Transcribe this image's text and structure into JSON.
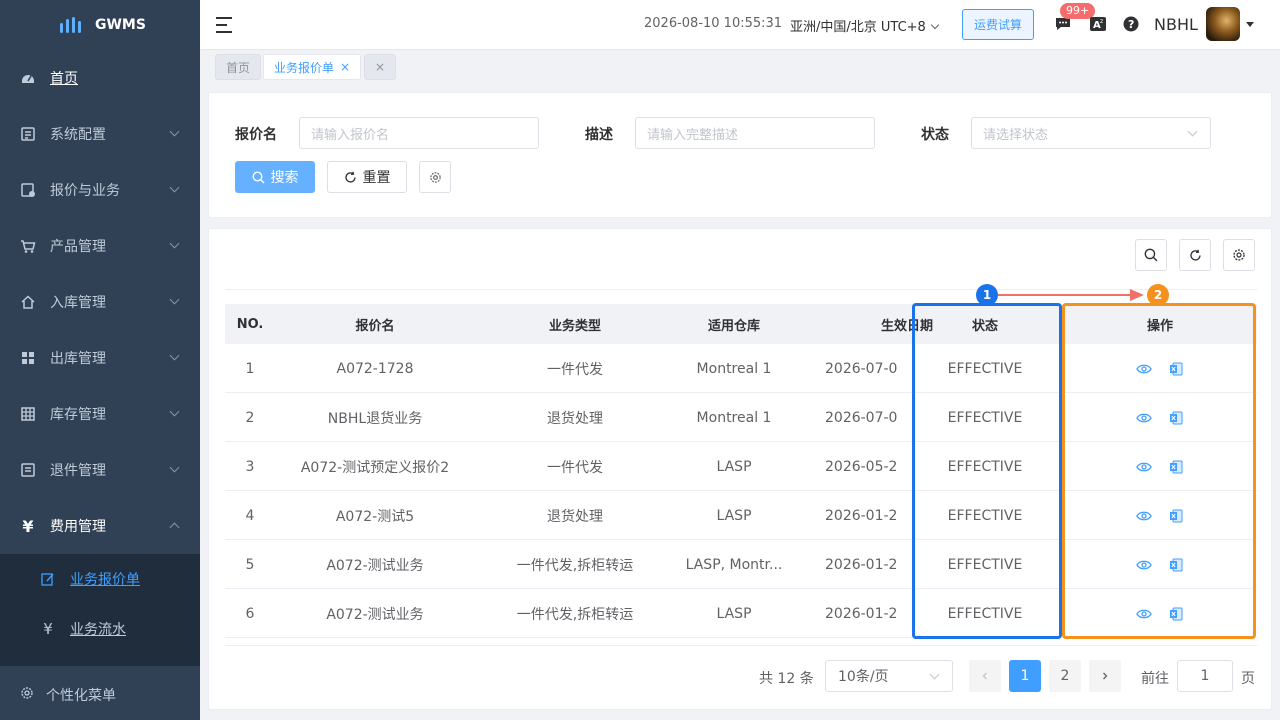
{
  "app": {
    "name": "GWMS"
  },
  "sidebar": {
    "items": [
      {
        "label": "首页",
        "icon": "dashboard-icon"
      },
      {
        "label": "系统配置",
        "icon": "config-icon"
      },
      {
        "label": "报价与业务",
        "icon": "quote-icon"
      },
      {
        "label": "产品管理",
        "icon": "cart-icon"
      },
      {
        "label": "入库管理",
        "icon": "home-icon"
      },
      {
        "label": "出库管理",
        "icon": "grid-icon"
      },
      {
        "label": "库存管理",
        "icon": "table-icon"
      },
      {
        "label": "退件管理",
        "icon": "return-icon"
      },
      {
        "label": "费用管理",
        "icon": "yen-icon"
      }
    ],
    "sub_items": [
      {
        "label": "业务报价单",
        "icon": "edit-icon"
      },
      {
        "label": "业务流水",
        "icon": "yen-icon"
      }
    ],
    "footer_label": "个性化菜单"
  },
  "navbar": {
    "datetime": "2026-08-10 10:55:31",
    "timezone": "亚洲/中国/北京 UTC+8",
    "freight_button": "运费试算",
    "message_badge": "99+",
    "username": "NBHL"
  },
  "tags": {
    "home": "首页",
    "active": "业务报价单",
    "close_symbol": "×"
  },
  "search": {
    "quote_name_label": "报价名",
    "quote_name_placeholder": "请输入报价名",
    "desc_label": "描述",
    "desc_placeholder": "请输入完整描述",
    "status_label": "状态",
    "status_placeholder": "请选择状态",
    "search_button": "搜索",
    "reset_button": "重置"
  },
  "table": {
    "columns": [
      "NO.",
      "报价名",
      "业务类型",
      "适用仓库",
      "生效日期",
      "状态",
      "操作"
    ],
    "rows": [
      {
        "no": "1",
        "name": "A072-1728",
        "type": "一件代发",
        "warehouse": "Montreal 1",
        "date": "2026-07-0",
        "status": "EFFECTIVE"
      },
      {
        "no": "2",
        "name": "NBHL退货业务",
        "type": "退货处理",
        "warehouse": "Montreal 1",
        "date": "2026-07-0",
        "status": "EFFECTIVE"
      },
      {
        "no": "3",
        "name": "A072-测试预定义报价2",
        "type": "一件代发",
        "warehouse": "LASP",
        "date": "2026-05-2",
        "status": "EFFECTIVE"
      },
      {
        "no": "4",
        "name": "A072-测试5",
        "type": "退货处理",
        "warehouse": "LASP",
        "date": "2026-01-2",
        "status": "EFFECTIVE"
      },
      {
        "no": "5",
        "name": "A072-测试业务",
        "type": "一件代发,拆柜转运",
        "warehouse": "LASP, Montr...",
        "date": "2026-01-2",
        "status": "EFFECTIVE"
      },
      {
        "no": "6",
        "name": "A072-测试业务",
        "type": "一件代发,拆柜转运",
        "warehouse": "LASP",
        "date": "2026-01-2",
        "status": "EFFECTIVE"
      }
    ]
  },
  "annotations": {
    "marker1": "1",
    "marker2": "2",
    "marker1_color": "#1a73e8",
    "marker2_color": "#f5921e",
    "arrow_color": "#f0706a"
  },
  "pagination": {
    "total_text": "共 12 条",
    "page_size": "10条/页",
    "pages": [
      "1",
      "2"
    ],
    "goto_label": "前往",
    "goto_value": "1",
    "page_unit": "页"
  }
}
